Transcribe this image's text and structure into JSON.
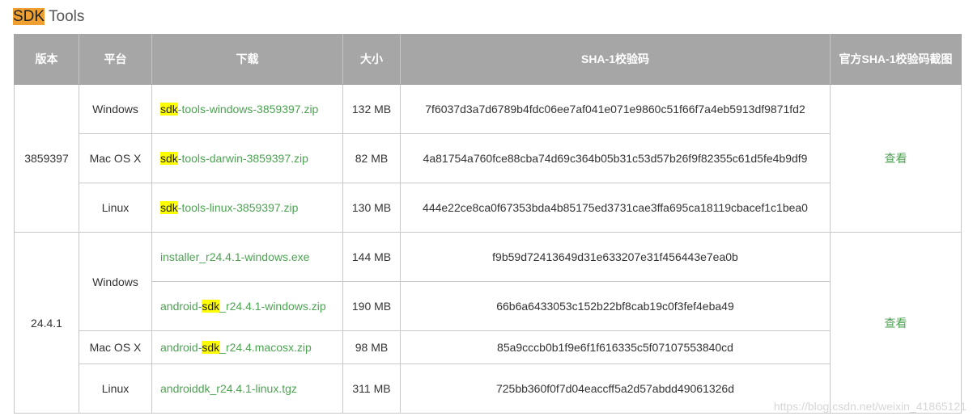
{
  "heading": {
    "highlight": "SDK",
    "rest": " Tools"
  },
  "table": {
    "headers": [
      "版本",
      "平台",
      "下载",
      "大小",
      "SHA-1校验码",
      "官方SHA-1校验码截图"
    ],
    "groups": [
      {
        "version": "3859397",
        "view_link": "查看",
        "rows": [
          {
            "platform": "Windows",
            "file_hl": "sdk",
            "file_rest": "-tools-windows-3859397.zip",
            "size": "132 MB",
            "sha1": "7f6037d3a7d6789b4fdc06ee7af041e071e9860c51f66f7a4eb5913df9871fd2"
          },
          {
            "platform": "Mac OS X",
            "file_hl": "sdk",
            "file_rest": "-tools-darwin-3859397.zip",
            "size": "82 MB",
            "sha1": "4a81754a760fce88cba74d69c364b05b31c53d57b26f9f82355c61d5fe4b9df9"
          },
          {
            "platform": "Linux",
            "file_hl": "sdk",
            "file_rest": "-tools-linux-3859397.zip",
            "size": "130 MB",
            "sha1": "444e22ce8ca0f67353bda4b85175ed3731cae3ffa695ca18119cbacef1c1bea0"
          }
        ]
      },
      {
        "version": "24.4.1",
        "view_link": "查看",
        "rows": [
          {
            "platform": "Windows",
            "file_pre": "installer_r24.4.1-windows.exe",
            "size": "144 MB",
            "sha1": "f9b59d72413649d31e633207e31f456443e7ea0b"
          },
          {
            "file_pre": "android-",
            "file_hl": "sdk",
            "file_rest": "_r24.4.1-windows.zip",
            "size": "190 MB",
            "sha1": "66b6a6433053c152b22bf8cab19c0f3fef4eba49"
          },
          {
            "platform": "Mac OS X",
            "file_pre": "android-",
            "file_hl": "sdk",
            "file_rest": "_r24.4.macosx.zip",
            "size": "98 MB",
            "sha1": "85a9cccb0b1f9e6f1f616335c5f07107553840cd"
          },
          {
            "platform": "Linux",
            "file_pre": "androiddk_r24.4.1-linux.tgz",
            "size": "311 MB",
            "sha1": "725bb360f0f7d04eaccff5a2d57abdd49061326d"
          }
        ]
      }
    ]
  },
  "watermark": "https://blog.csdn.net/weixin_41865121",
  "colors": {
    "link": "#4ca352",
    "header_bg": "#a6a6a6",
    "highlight_yellow": "#ffff00",
    "highlight_orange": "#f0a030"
  }
}
